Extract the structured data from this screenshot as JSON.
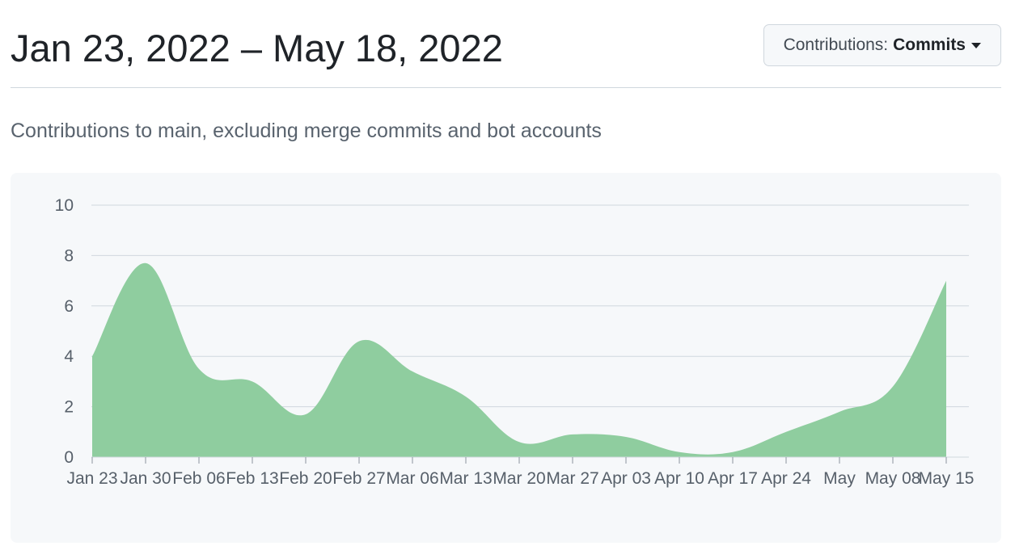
{
  "header": {
    "date_range": "Jan 23, 2022 – May 18, 2022",
    "contributions_label": "Contributions:",
    "contributions_value": "Commits"
  },
  "subtitle": "Contributions to main, excluding merge commits and bot accounts",
  "colors": {
    "area_fill": "#8fcd9f",
    "grid": "#d0d7de",
    "panel": "#f6f8fa"
  },
  "icons": {
    "dropdown": "caret-down-icon"
  },
  "chart_data": {
    "type": "area",
    "x_tick_labels": [
      "Jan 23",
      "Jan 30",
      "Feb 06",
      "Feb 13",
      "Feb 20",
      "Feb 27",
      "Mar 06",
      "Mar 13",
      "Mar 20",
      "Mar 27",
      "Apr 03",
      "Apr 10",
      "Apr 17",
      "Apr 24",
      "May",
      "May 08",
      "May 15"
    ],
    "y_tick_labels": [
      "0",
      "2",
      "4",
      "6",
      "8",
      "10"
    ],
    "ylim": [
      0,
      10
    ],
    "grid": true,
    "series": [
      {
        "x": [
          "Jan 23",
          "Jan 30",
          "Feb 06",
          "Feb 13",
          "Feb 20",
          "Feb 27",
          "Mar 06",
          "Mar 13",
          "Mar 20",
          "Mar 27",
          "Apr 03",
          "Apr 10",
          "Apr 17",
          "Apr 24",
          "May",
          "May 08",
          "May 15"
        ],
        "values": [
          4,
          7.7,
          3.5,
          3,
          1.7,
          4.6,
          3.4,
          2.4,
          0.6,
          0.9,
          0.8,
          0.2,
          0.2,
          1,
          1.8,
          2.8,
          7
        ]
      }
    ]
  }
}
